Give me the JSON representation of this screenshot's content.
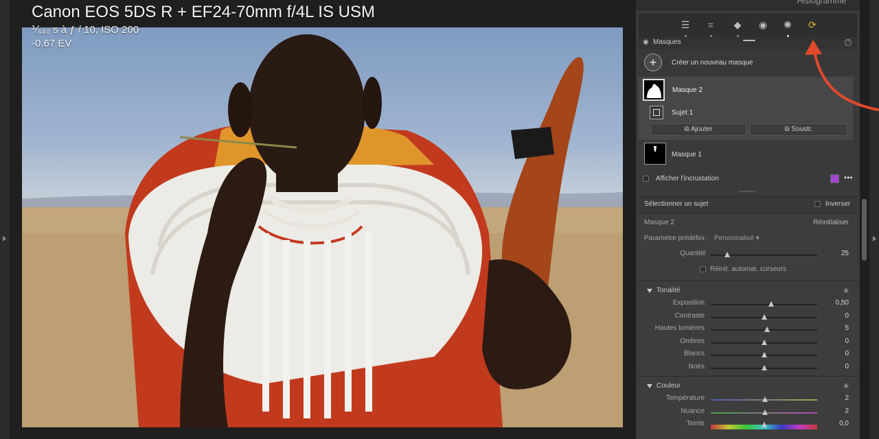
{
  "photo_info": {
    "camera": "Canon EOS 5DS R + EF24-70mm f/4L IS USM",
    "exposure": "⅟₆₄₀ s à ƒ / 10, ISO 200",
    "ev": "-0.67 EV"
  },
  "panel": {
    "histogram_label": "Histogramme",
    "tools": [
      "sliders-icon",
      "crop-icon",
      "eraser-icon",
      "eye-redeye-icon",
      "masking-icon",
      "presets-icon"
    ],
    "masks": {
      "header": "Masques",
      "create_label": "Créer un nouveau masque",
      "mask2_name": "Masque 2",
      "subject_name": "Sujet 1",
      "add_label": "Ajouter",
      "subtract_label": "Soustr.",
      "mask1_name": "Masque 1",
      "overlay_label": "Afficher l'incrustation",
      "overlay_color": "#a046cf"
    },
    "select_subject": {
      "label": "Sélectionner un sujet",
      "invert_label": "Inverser"
    },
    "mask_settings": {
      "title": "Masque 2",
      "reset_label": "Réinitialiser",
      "preset_label": "Paramètre prédéfini :",
      "preset_value": "Personnalisé",
      "amount_label": "Quantité",
      "amount_value": "25",
      "auto_reset_label": "Réinit. automat. curseurs"
    },
    "tone": {
      "title": "Tonalité",
      "rows": [
        {
          "label": "Exposition",
          "value": "0,50",
          "pos": 0.57
        },
        {
          "label": "Contraste",
          "value": "0",
          "pos": 0.5
        },
        {
          "label": "Hautes lumières",
          "value": "5",
          "pos": 0.53
        },
        {
          "label": "Ombres",
          "value": "0",
          "pos": 0.5
        },
        {
          "label": "Blancs",
          "value": "0",
          "pos": 0.5
        },
        {
          "label": "Noirs",
          "value": "0",
          "pos": 0.5
        }
      ]
    },
    "color": {
      "title": "Couleur",
      "rows": [
        {
          "label": "Température",
          "value": "2",
          "pos": 0.51
        },
        {
          "label": "Nuance",
          "value": "2",
          "pos": 0.51
        },
        {
          "label": "Teinte",
          "value": "0,0",
          "pos": 0.5
        }
      ]
    }
  }
}
